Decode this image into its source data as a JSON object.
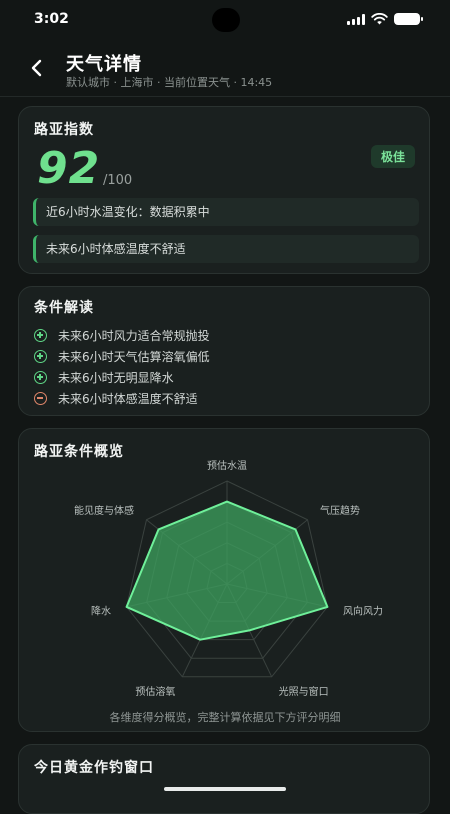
{
  "status_bar": {
    "time": "3:02"
  },
  "header": {
    "title": "天气详情",
    "subtitle": "默认城市 · 上海市 · 当前位置天气 · 14:45"
  },
  "score_card": {
    "title": "路亚指数",
    "score": "92",
    "max": "/100",
    "badge": "极佳",
    "notes": [
      "近6小时水温变化：数据积累中",
      "未来6小时体感温度不舒适"
    ]
  },
  "conditions": {
    "title": "条件解读",
    "items": [
      {
        "text": "未来6小时风力适合常规抛投",
        "type": "positive"
      },
      {
        "text": "未来6小时天气估算溶氧偏低",
        "type": "positive"
      },
      {
        "text": "未来6小时无明显降水",
        "type": "positive"
      },
      {
        "text": "未来6小时体感温度不舒适",
        "type": "negative"
      }
    ]
  },
  "radar": {
    "title": "路亚条件概览",
    "footnote": "各维度得分概览，完整计算依据见下方评分明细",
    "chart_data": {
      "type": "radar",
      "axes": [
        "预估水温",
        "气压趋势",
        "风向风力",
        "光照与窗口",
        "预估溶氧",
        "降水",
        "能见度与体感"
      ],
      "values": [
        0.8,
        0.85,
        1.0,
        0.5,
        0.6,
        1.0,
        0.85
      ],
      "max": 1.0,
      "rings": 5,
      "fill_color": "#3ea25f",
      "stroke_color": "#6ff09a"
    }
  },
  "golden_window": {
    "title": "今日黄金作钓窗口"
  },
  "colors": {
    "accent": "#6fe08e",
    "negative": "#e0866a",
    "background": "#121615",
    "card": "#1a201f"
  }
}
